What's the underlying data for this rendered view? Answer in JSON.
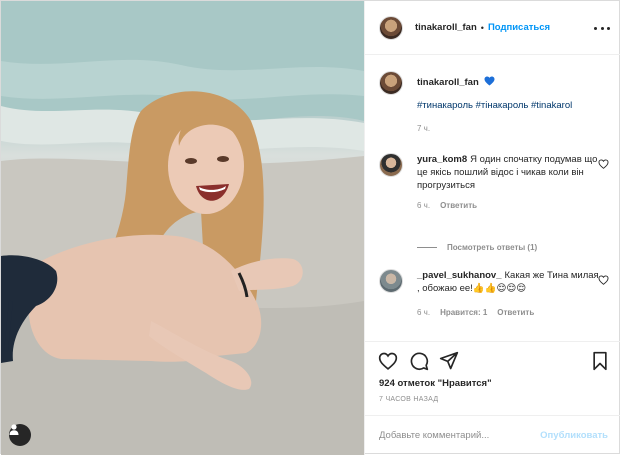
{
  "header": {
    "username": "tinakaroll_fan",
    "separator": "•",
    "follow_label": "Подписаться",
    "more_icon": "more-dots-icon"
  },
  "caption": {
    "username": "tinakaroll_fan",
    "emoji": "blue-heart",
    "hashtags": "#тинакароль #тінакароль #tinakarol",
    "time": "7 ч."
  },
  "comments": [
    {
      "username": "yura_kom8",
      "text": "Я один спочатку подумав що це якісь пошлий відос і чикав коли він прогрузиться",
      "time": "6 ч.",
      "reply_label": "Ответить"
    },
    {
      "username": "_pavel_sukhanov_",
      "text": "Какая же Тина милая , обожаю ее!👍👍😌😌😌",
      "time": "6 ч.",
      "likes_label": "Нравится: 1",
      "reply_label": "Ответить"
    }
  ],
  "view_replies": "Посмотреть ответы (1)",
  "actions": {
    "likes": "924 отметок \"Нравится\"",
    "time_ago": "7 ЧАСОВ НАЗАД"
  },
  "add_comment": {
    "placeholder": "Добавьте комментарий...",
    "publish_label": "Опубликовать"
  },
  "colors": {
    "accent": "#0095f6",
    "hashtag": "#00376b",
    "muted": "#8e8e8e",
    "publish_disabled": "#b2dffc"
  }
}
